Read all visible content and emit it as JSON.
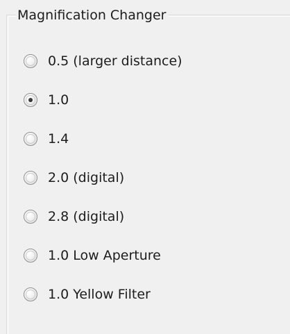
{
  "group": {
    "title": "Magnification Changer"
  },
  "options": [
    {
      "label": "0.5 (larger distance)",
      "checked": false
    },
    {
      "label": "1.0",
      "checked": true
    },
    {
      "label": "1.4",
      "checked": false
    },
    {
      "label": "2.0 (digital)",
      "checked": false
    },
    {
      "label": "2.8 (digital)",
      "checked": false
    },
    {
      "label": "1.0 Low Aperture",
      "checked": false
    },
    {
      "label": "1.0 Yellow Filter",
      "checked": false
    }
  ]
}
